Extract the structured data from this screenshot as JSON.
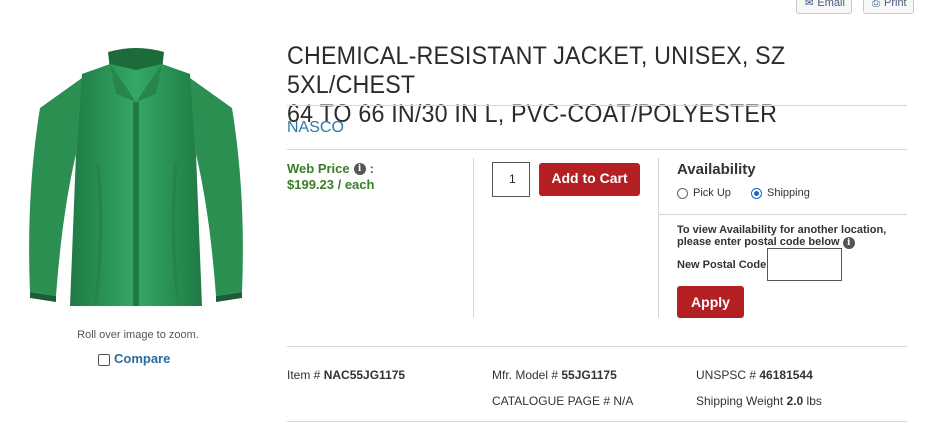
{
  "toolbar": {
    "email_label": "Email",
    "print_label": "Print"
  },
  "product": {
    "title_line1": "CHEMICAL-RESISTANT JACKET, UNISEX, SZ 5XL/CHEST",
    "title_line2": "64 TO 66 IN/30 IN L, PVC-COAT/POLYESTER",
    "brand": "NASCO",
    "image_color": "#2e9a5a"
  },
  "gallery": {
    "zoom_hint": "Roll over image to zoom.",
    "compare_label": "Compare"
  },
  "pricing": {
    "label": "Web Price",
    "colon": ":",
    "price": "$199.23 / each",
    "color": "#3a7d2a"
  },
  "cart": {
    "quantity": "1",
    "add_label": "Add to Cart",
    "button_color": "#b41f24"
  },
  "availability": {
    "title": "Availability",
    "options": [
      {
        "label": "Pick Up",
        "selected": false
      },
      {
        "label": "Shipping",
        "selected": true
      }
    ],
    "note": "To view Availability for another location, please enter postal code below",
    "postal_label": "New Postal Code",
    "postal_value": "",
    "apply_label": "Apply"
  },
  "specs": {
    "item_label": "Item #",
    "item_value": "NAC55JG1175",
    "mfr_label": "Mfr. Model #",
    "mfr_value": "55JG1175",
    "unspsc_label": "UNSPSC #",
    "unspsc_value": "46181544",
    "catalogue_label": "CATALOGUE PAGE #",
    "catalogue_value": "N/A",
    "weight_label": "Shipping Weight",
    "weight_value": "2.0",
    "weight_unit": "lbs"
  }
}
